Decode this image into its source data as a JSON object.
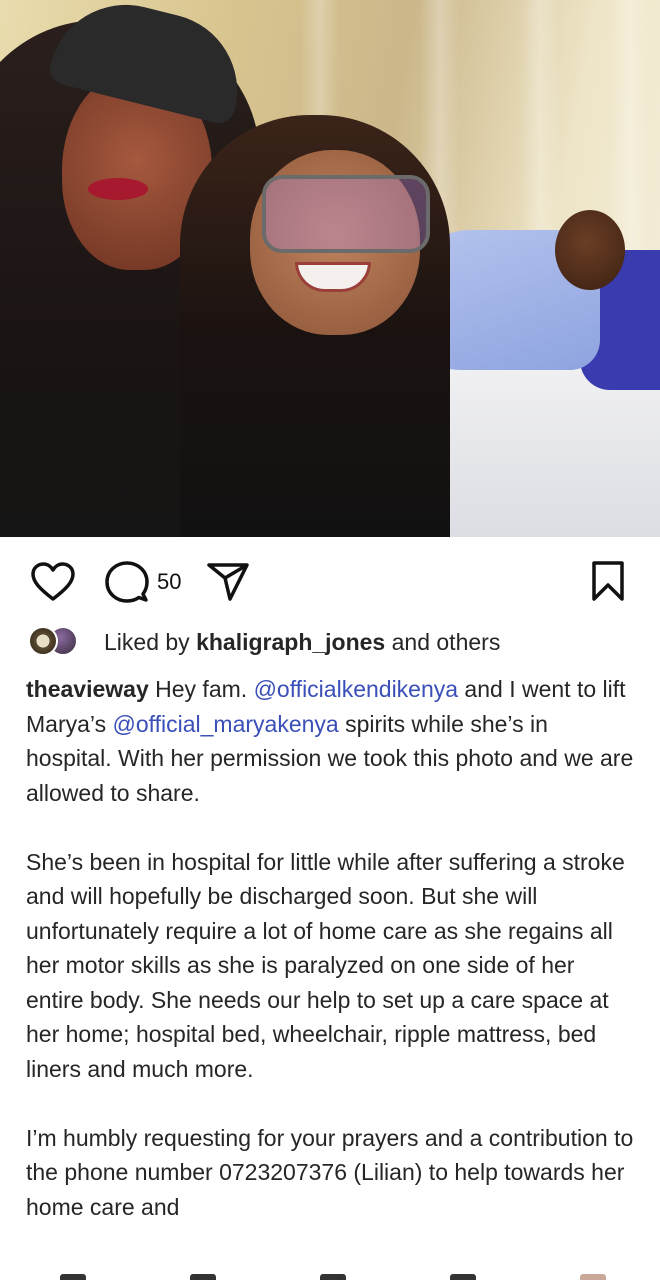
{
  "post": {
    "comment_count": "50",
    "liked_by_prefix": "Liked by ",
    "liked_by_user": "khaligraph_jones",
    "liked_by_suffix": " and others",
    "username": "theavieway",
    "caption": {
      "p1_a": "Hey fam. ",
      "mention1": "@officialkendikenya",
      "p1_b": " and I went to lift Marya’s ",
      "mention2": "@official_maryakenya",
      "p1_c": " spirits while she’s in hospital. With her permission we took this photo and we are allowed to share.",
      "p2": "She’s been in hospital for little while after suffering a stroke and will hopefully be discharged soon. But she will unfortunately require a lot of home care as she regains all her motor skills as she is paralyzed on one side of her entire body. She needs our help to set up a care space at her home; hospital bed, wheelchair, ripple mattress, bed liners and much more.",
      "p3": "I’m humbly requesting for your prayers and a contribution to the phone number 0723207376 (Lilian) to help towards her home care and"
    }
  },
  "icons": {
    "like": "heart-icon",
    "comment": "comment-bubble-icon",
    "share": "paper-plane-icon",
    "save": "bookmark-icon"
  }
}
